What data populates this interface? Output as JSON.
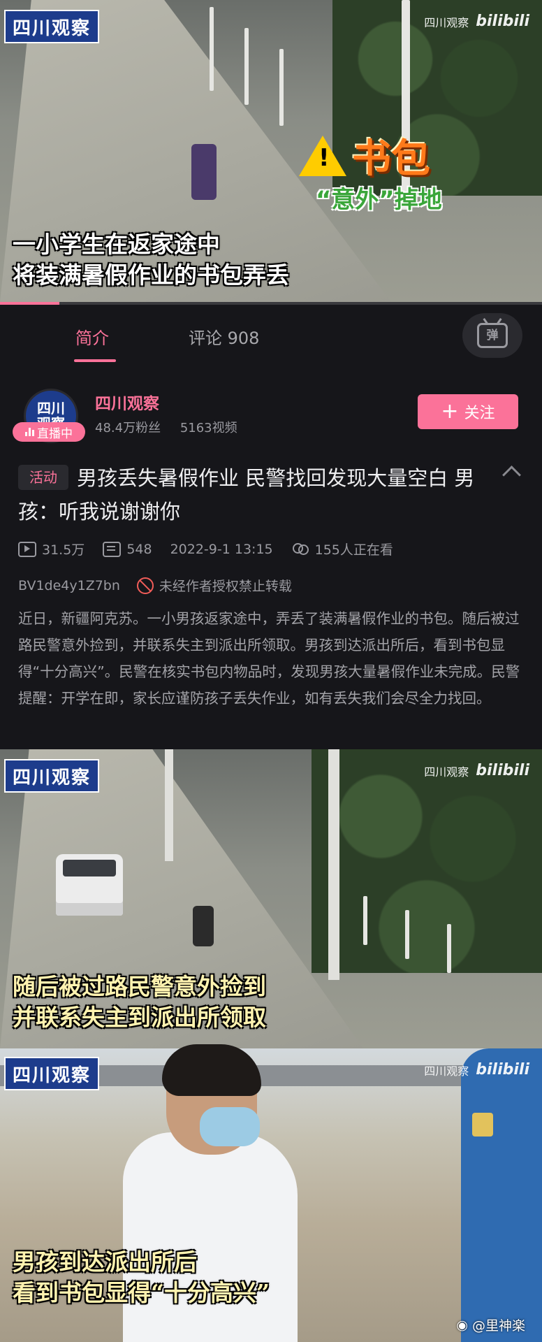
{
  "video_top": {
    "logo": "四川观察",
    "watermark": {
      "channel": "四川观察",
      "site": "bilibili"
    },
    "sticker": {
      "title": "书包",
      "subtitle": "“意外”掉地"
    },
    "caption_lines": [
      "一小学生在返家途中",
      "将装满暑假作业的书包弄丢"
    ],
    "progress": 0.11
  },
  "tabs": {
    "intro": "简介",
    "comments": "评论 908",
    "danmaku_icon": "danmaku-toggle-icon"
  },
  "uploader": {
    "avatar_text": "四川\n观察",
    "live_label": "直播中",
    "name": "四川观察",
    "followers": "48.4万粉丝",
    "videos": "5163视频",
    "follow_label": "关注"
  },
  "video": {
    "activity_tag": "活动",
    "title": "男孩丢失暑假作业 民警找回发现大量空白 男孩：听我说谢谢你",
    "views": "31.5万",
    "danmaku_count": "548",
    "date": "2022-9-1 13:15",
    "watching": "155人正在看",
    "bvid": "BV1de4y1Z7bn",
    "reprint_notice": "未经作者授权禁止转载",
    "description": "近日，新疆阿克苏。一小男孩返家途中，弄丢了装满暑假作业的书包。随后被过路民警意外捡到，并联系失主到派出所领取。男孩到达派出所后，看到书包显得“十分高兴”。民警在核实书包内物品时，发现男孩大量暑假作业未完成。民警提醒：开学在即，家长应谨防孩子丢失作业，如有丢失我们会尽全力找回。"
  },
  "frame2": {
    "logo": "四川观察",
    "watermark": {
      "channel": "四川观察",
      "site": "bilibili"
    },
    "caption_lines": [
      "随后被过路民警意外捡到",
      "并联系失主到派出所领取"
    ]
  },
  "frame3": {
    "logo": "四川观察",
    "watermark": {
      "channel": "四川观察",
      "site": "bilibili"
    },
    "caption_lines": [
      "男孩到达派出所后",
      "看到书包显得“十分高兴”"
    ]
  },
  "weibo_watermark": "@里神楽",
  "colors": {
    "accent": "#fb7299",
    "background": "#16161a",
    "logo_blue": "#1d3c8c"
  }
}
